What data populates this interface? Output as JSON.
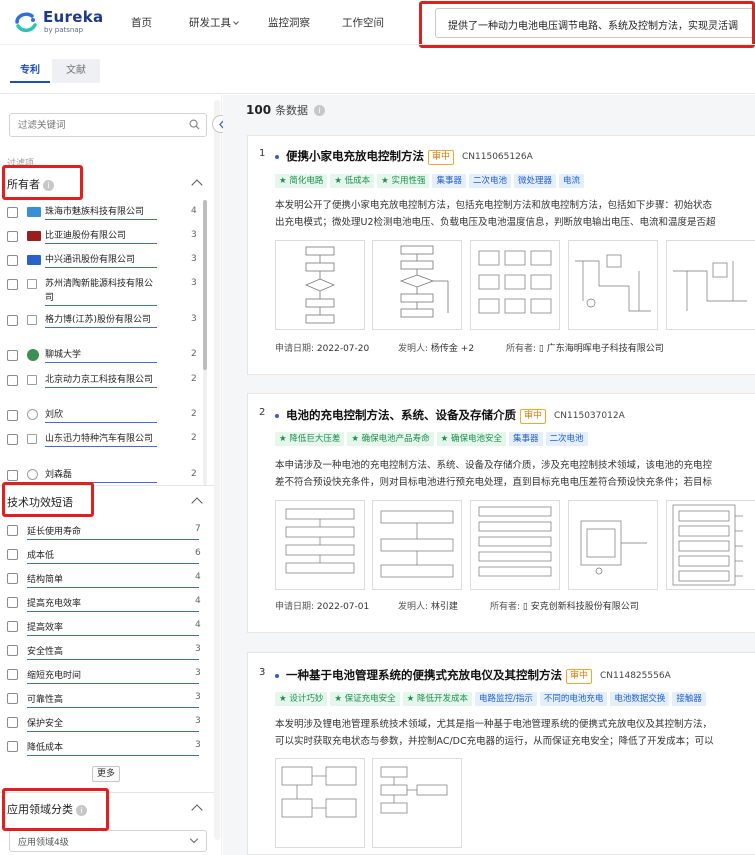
{
  "brand": {
    "name": "Eureka",
    "sub": "by patsnap"
  },
  "nav": [
    "首页",
    "研发工具",
    "监控洞察",
    "工作空间"
  ],
  "search": {
    "query": "提供了一种动力电池电压调节电路、系统及控制方法，实现灵活调"
  },
  "tabs": [
    "专利",
    "文献"
  ],
  "sidebar": {
    "filter_placeholder": "过滤关键词",
    "filter_label": "过滤项",
    "owners_title": "所有者",
    "owners": [
      {
        "name": "珠海市魅族科技有限公司",
        "count": "4",
        "color": "#3a8fd9"
      },
      {
        "name": "比亚迪股份有限公司",
        "count": "3",
        "color": "#9b1d1d"
      },
      {
        "name": "中兴通讯股份有限公司",
        "count": "3",
        "color": "#2a62c9"
      },
      {
        "name": "苏州清陶新能源科技有限公司",
        "count": "3",
        "color": "#9aa0a8"
      },
      {
        "name": "格力博(江苏)股份有限公司",
        "count": "3",
        "color": "#9aa0a8"
      },
      {
        "name": "聊城大学",
        "count": "2",
        "color": "#3c8f52"
      },
      {
        "name": "北京动力京工科技有限公司",
        "count": "2",
        "color": "#9aa0a8"
      },
      {
        "name": "刘欣",
        "count": "2",
        "color": "#9aa0a8"
      },
      {
        "name": "山东迅力特种汽车有限公司",
        "count": "2",
        "color": "#9aa0a8"
      },
      {
        "name": "刘森磊",
        "count": "2",
        "color": "#9aa0a8"
      }
    ],
    "tech_title": "技术功效短语",
    "tech": [
      {
        "name": "延长使用寿命",
        "count": "7"
      },
      {
        "name": "成本低",
        "count": "6"
      },
      {
        "name": "结构简单",
        "count": "4"
      },
      {
        "name": "提高充电效率",
        "count": "4"
      },
      {
        "name": "提高效率",
        "count": "4"
      },
      {
        "name": "安全性高",
        "count": "3"
      },
      {
        "name": "缩短充电时间",
        "count": "3"
      },
      {
        "name": "可靠性高",
        "count": "3"
      },
      {
        "name": "保护安全",
        "count": "3"
      },
      {
        "name": "降低成本",
        "count": "3"
      }
    ],
    "more": "更多",
    "app_title": "应用领域分类",
    "app_select": "应用领域4级"
  },
  "results": {
    "count": "100",
    "label": "条数据"
  },
  "cards": [
    {
      "num": "1",
      "title": "便携小家电充放电控制方法",
      "status": "审中",
      "pubnum": "CN115065126A",
      "tags": [
        {
          "t": "★ 简化电路",
          "c": "g"
        },
        {
          "t": "★ 低成本",
          "c": "g"
        },
        {
          "t": "★ 实用性强",
          "c": "g"
        },
        {
          "t": "集事器",
          "c": "b"
        },
        {
          "t": "二次电池",
          "c": "b"
        },
        {
          "t": "微处理器",
          "c": "b"
        },
        {
          "t": "电流",
          "c": "b"
        }
      ],
      "abs1": "本发明公开了便携小家电充放电控制方法，包括充电控制方法和放电控制方法，包括如下步骤：初始状态",
      "abs2": "出充电模式；微处理U2检测电池电压、负载电压及电池温度信息，判断放电输出电压、电流和温度是否超",
      "date_label": "申请日期:",
      "date": "2022-07-20",
      "inventor_label": "发明人:",
      "inventor": "杨传金 +2",
      "owner_label": "所有者:",
      "owner": "广东海明晖电子科技有限公司"
    },
    {
      "num": "2",
      "title": "电池的充电控制方法、系统、设备及存储介质",
      "status": "审中",
      "pubnum": "CN115037012A",
      "tags": [
        {
          "t": "★ 降低巨大压差",
          "c": "g"
        },
        {
          "t": "★ 确保电池产品寿命",
          "c": "g"
        },
        {
          "t": "★ 确保电池安全",
          "c": "g"
        },
        {
          "t": "集事器",
          "c": "b"
        },
        {
          "t": "二次电池",
          "c": "b"
        }
      ],
      "abs1": "本申请涉及一种电池的充电控制方法、系统、设备及存储介质，涉及充电控制技术领域，该电池的充电控",
      "abs2": "差不符合预设快充条件，则对目标电池进行预充电处理，直到目标充电电压差符合预设快充条件；若目标",
      "date_label": "申请日期:",
      "date": "2022-07-01",
      "inventor_label": "发明人:",
      "inventor": "林引建",
      "owner_label": "所有者:",
      "owner": "安克创新科技股份有限公司"
    },
    {
      "num": "3",
      "title": "一种基于电池管理系统的便携式充放电仪及其控制方法",
      "status": "审中",
      "pubnum": "CN114825556A",
      "tags": [
        {
          "t": "★ 设计巧妙",
          "c": "g"
        },
        {
          "t": "★ 保证充电安全",
          "c": "g"
        },
        {
          "t": "★ 降低开发成本",
          "c": "g"
        },
        {
          "t": "电路监控/指示",
          "c": "b"
        },
        {
          "t": "不同的电池充电",
          "c": "b"
        },
        {
          "t": "电池数据交换",
          "c": "b"
        },
        {
          "t": "接触器",
          "c": "b"
        }
      ],
      "abs1": "本发明涉及锂电池管理系统技术领域，尤其是指一种基于电池管理系统的便携式充放电仪及其控制方法，",
      "abs2": "可以实时获取充电状态与参数，并控制AC/DC充电器的运行，从而保证充电安全；降低了开发成本；可以",
      "date_label": "",
      "date": "",
      "inventor_label": "",
      "inventor": "",
      "owner_label": "",
      "owner": ""
    }
  ]
}
